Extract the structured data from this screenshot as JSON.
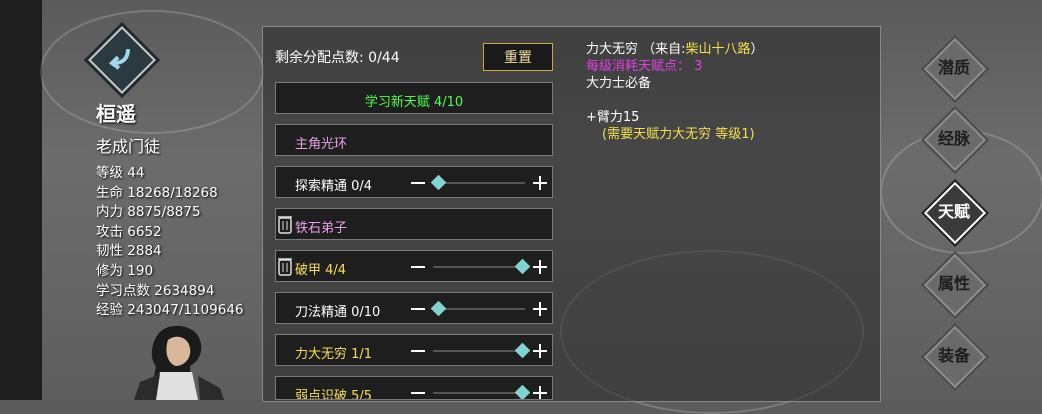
{
  "character": {
    "name": "桓遥",
    "title": "老成门徒",
    "stats": [
      "等级 44",
      "生命 18268/18268",
      "内力 8875/8875",
      "攻击 6652",
      "韧性 2884",
      "修为 190",
      "学习点数 2634894",
      "经验 243047/1109646"
    ]
  },
  "panel": {
    "remaining_label": "剩余分配点数: 0/44",
    "reset_label": "重置"
  },
  "talents": [
    {
      "label": "学习新天赋 4/10"
    },
    {
      "label": "主角光环"
    },
    {
      "label": "探索精通 0/4",
      "level": 0,
      "max": 4
    },
    {
      "label": "铁石弟子"
    },
    {
      "label": "破甲 4/4",
      "level": 4,
      "max": 4
    },
    {
      "label": "刀法精通 0/10",
      "level": 0,
      "max": 10
    },
    {
      "label": "力大无穷 1/1",
      "level": 1,
      "max": 1
    },
    {
      "label": "弱点识破 5/5",
      "level": 5,
      "max": 5
    }
  ],
  "detail": {
    "title": "力大无穷 （来自:",
    "source": "柴山十八路",
    "title_end": "）",
    "cost": "每级消耗天赋点： 3",
    "desc": "大力士必备",
    "effect": "+臂力15",
    "requirement": "(需要天赋力大无穷 等级1)"
  },
  "menu": [
    {
      "label": "潜质",
      "active": false
    },
    {
      "label": "经脉",
      "active": false
    },
    {
      "label": "天赋",
      "active": true
    },
    {
      "label": "属性",
      "active": false
    },
    {
      "label": "装备",
      "active": false
    }
  ],
  "colors": {
    "accent_green": "#4cff4c",
    "accent_yellow": "#f5e04a",
    "accent_magenta": "#e040e0",
    "knob": "#7fd6d0"
  }
}
